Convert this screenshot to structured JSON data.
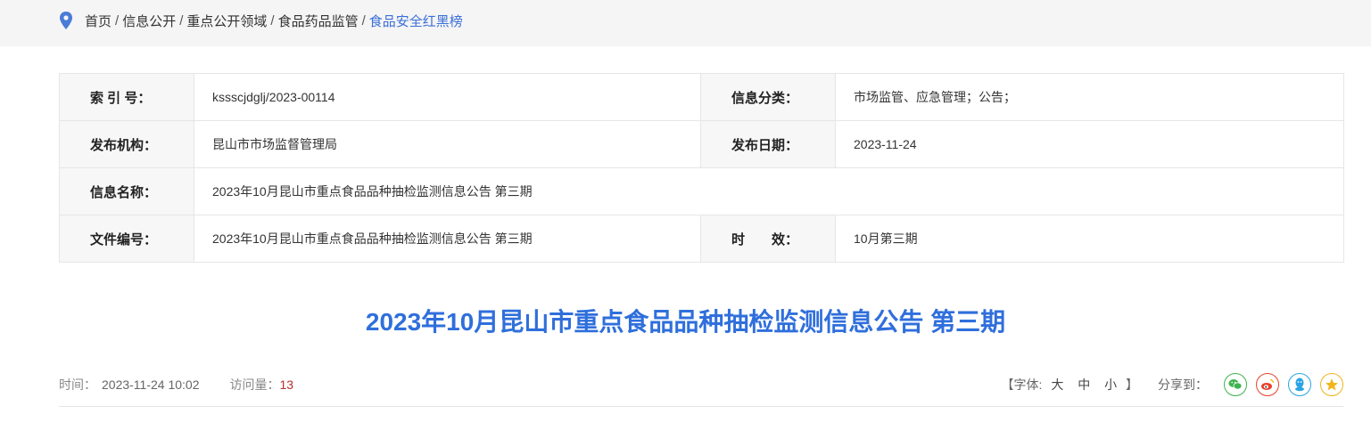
{
  "breadcrumb": {
    "items": [
      "首页",
      "信息公开",
      "重点公开领域",
      "食品药品监管"
    ],
    "current": "食品安全红黑榜",
    "separator": "/"
  },
  "meta": {
    "index_label": "索 引 号：",
    "index_value": "ksssсjdglj/2023-00114",
    "category_label": "信息分类：",
    "category_value": "市场监管、应急管理；公告；",
    "publisher_label": "发布机构：",
    "publisher_value": "昆山市市场监督管理局",
    "date_label": "发布日期：",
    "date_value": "2023-11-24",
    "name_label": "信息名称：",
    "name_value": "2023年10月昆山市重点食品品种抽检监测信息公告 第三期",
    "docno_label": "文件编号：",
    "docno_value": "2023年10月昆山市重点食品品种抽检监测信息公告 第三期",
    "validity_label": "时　　效：",
    "validity_value": "10月第三期"
  },
  "article": {
    "title": "2023年10月昆山市重点食品品种抽检监测信息公告 第三期"
  },
  "info": {
    "time_label": "时间：",
    "time_value": "2023-11-24 10:02",
    "visits_label": "访问量：",
    "visits_value": "13",
    "font_open": "【字体:",
    "font_large": "大",
    "font_medium": "中",
    "font_small": "小",
    "font_close": "】",
    "share_label": "分享到："
  },
  "share_icons": [
    "wechat-icon",
    "weibo-icon",
    "qq-icon",
    "qzone-icon"
  ],
  "colors": {
    "accent": "#2f6fdc",
    "wechat": "#3fb34f",
    "weibo": "#e8422d",
    "qq": "#2aa4e3",
    "qzone": "#f1b51c",
    "visits": "#b8312f"
  }
}
